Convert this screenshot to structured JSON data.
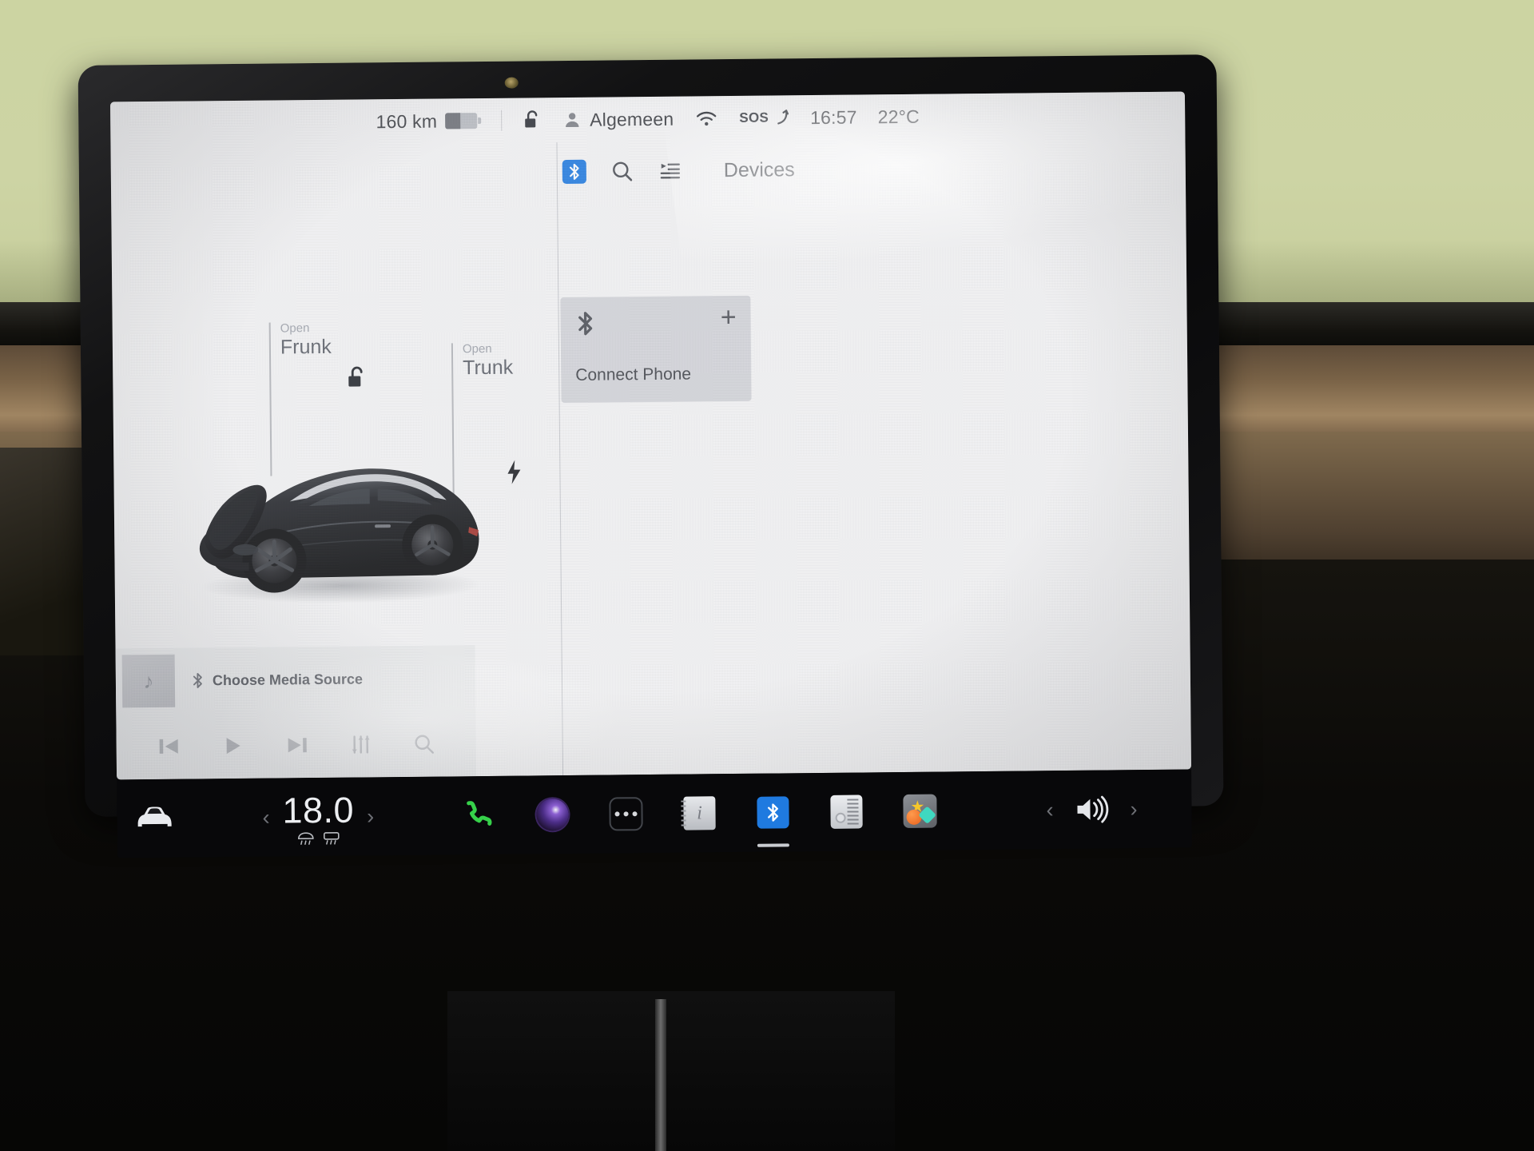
{
  "status_bar": {
    "range": "160 km",
    "battery_level_percent": 48,
    "lock_icon": "unlock-icon",
    "profile_icon": "person-icon",
    "profile_name": "Algemeen",
    "wifi_icon": "wifi-icon",
    "sos_label": "SOS",
    "time": "16:57",
    "temperature": "22°C"
  },
  "car_view": {
    "frunk": {
      "action": "Open",
      "label": "Frunk"
    },
    "trunk": {
      "action": "Open",
      "label": "Trunk"
    },
    "lock_icon": "unlock-icon",
    "charge_icon": "charge-bolt-icon",
    "vehicle": "Tesla Model 3 black"
  },
  "media_player": {
    "album_art_icon": "music-note-icon",
    "source_icon": "bluetooth-icon",
    "source_label": "Choose Media Source",
    "controls": [
      {
        "name": "previous-track-button",
        "icon": "skip-previous-icon"
      },
      {
        "name": "play-button",
        "icon": "play-icon"
      },
      {
        "name": "next-track-button",
        "icon": "skip-next-icon"
      },
      {
        "name": "equalizer-button",
        "icon": "sliders-icon"
      },
      {
        "name": "search-button",
        "icon": "search-icon"
      }
    ]
  },
  "devices_panel": {
    "bluetooth_toggle_icon": "bluetooth-icon",
    "search_icon": "search-icon",
    "list_icon": "playlist-icon",
    "title": "Devices",
    "connect_card": {
      "icon": "bluetooth-icon",
      "add_icon": "plus-icon",
      "label": "Connect Phone"
    }
  },
  "taskbar": {
    "car_icon": "car-icon",
    "climate": {
      "decrease_icon": "chevron-left-icon",
      "value": "18.0",
      "increase_icon": "chevron-right-icon",
      "defrost_front_icon": "defrost-front-icon",
      "defrost_rear_icon": "defrost-rear-icon"
    },
    "apps": [
      {
        "name": "phone-app-icon",
        "label": "Phone",
        "active": false
      },
      {
        "name": "camera-app-icon",
        "label": "Camera",
        "active": false
      },
      {
        "name": "more-apps-icon",
        "label": "More",
        "active": false
      },
      {
        "name": "manual-app-icon",
        "label": "Manual",
        "active": false
      },
      {
        "name": "bluetooth-app-icon",
        "label": "Bluetooth",
        "active": true
      },
      {
        "name": "toybox-app-icon",
        "label": "Toybox",
        "active": false
      },
      {
        "name": "arcade-app-icon",
        "label": "Arcade",
        "active": false
      }
    ],
    "volume": {
      "decrease_icon": "chevron-left-icon",
      "speaker_icon": "volume-icon",
      "increase_icon": "chevron-right-icon"
    }
  },
  "colors": {
    "bluetooth_blue": "#1f7ae0",
    "screen_bg": "#f3f3f4",
    "taskbar_bg": "#08080a",
    "text_primary": "#3e4147",
    "text_secondary": "#9ea2ab"
  }
}
